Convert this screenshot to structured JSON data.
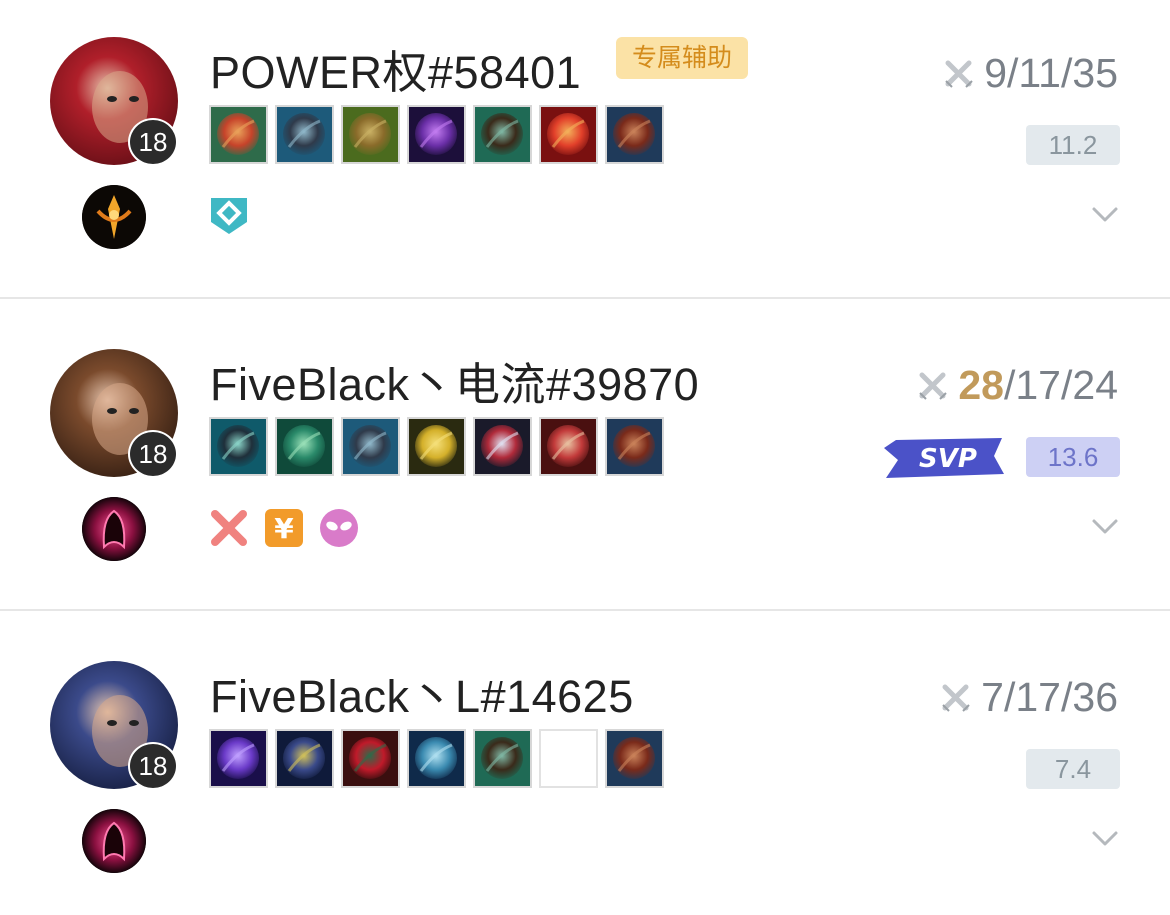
{
  "players": [
    {
      "name": "POWER权#58401",
      "level": "18",
      "role_tag": "专属辅助",
      "kda": {
        "kills": "9",
        "deaths": "11",
        "assists": "35",
        "highlight_kills": false
      },
      "score": "11.2",
      "svp": false,
      "avatar_colors": [
        "#b01f2a",
        "#5e0d14"
      ],
      "rune_icon": "precision-rune-icon",
      "items": [
        "item-red-orb-icon",
        "item-boots-icon",
        "item-green-armor-icon",
        "item-purple-mask-icon",
        "item-chain-shield-icon",
        "item-fire-orb-icon",
        "item-warding-icon"
      ],
      "tags": [
        "diamond-shield-icon"
      ]
    },
    {
      "name": "FiveBlack丶电流#39870",
      "level": "18",
      "role_tag": "",
      "kda": {
        "kills": "28",
        "deaths": "17",
        "assists": "24",
        "highlight_kills": true
      },
      "score": "13.6",
      "svp": true,
      "svp_label": "SVP",
      "avatar_colors": [
        "#7a4a2c",
        "#2d1a10"
      ],
      "rune_icon": "domination-rune-icon",
      "items": [
        "item-blaster-icon",
        "item-green-disc-icon",
        "item-boots-icon",
        "item-lightning-blade-icon",
        "item-red-spear-icon",
        "item-red-sword-icon",
        "item-warding-icon"
      ],
      "tags": [
        "crossed-swords-tag-icon",
        "gold-yen-icon",
        "alien-face-icon"
      ]
    },
    {
      "name": "FiveBlack丶L#14625",
      "level": "18",
      "role_tag": "",
      "kda": {
        "kills": "7",
        "deaths": "17",
        "assists": "36",
        "highlight_kills": false
      },
      "score": "7.4",
      "svp": false,
      "avatar_colors": [
        "#3b4a8a",
        "#121a3a"
      ],
      "rune_icon": "domination-rune-icon",
      "items": [
        "item-purple-staff-icon",
        "item-dark-helm-icon",
        "item-red-boots-icon",
        "item-ice-branch-icon",
        "item-chain-shield-icon",
        "empty",
        "item-warding-icon"
      ],
      "tags": []
    }
  ]
}
